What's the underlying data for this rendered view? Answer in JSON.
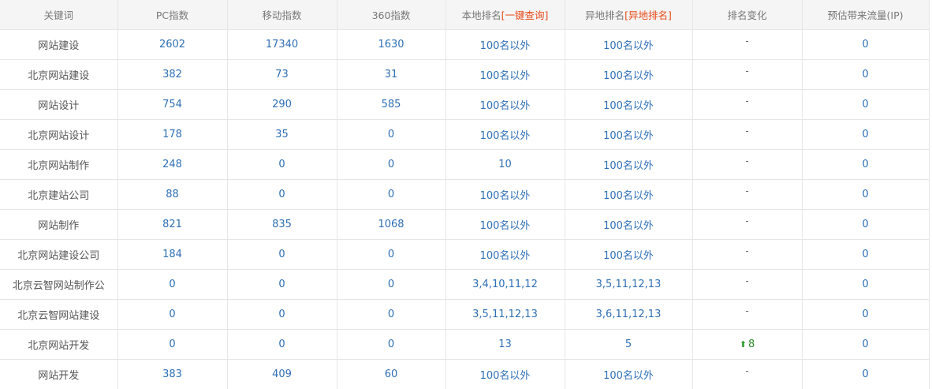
{
  "headers": {
    "keyword": "关键词",
    "pc": "PC指数",
    "mobile": "移动指数",
    "idx360": "360指数",
    "local_rank": "本地排名",
    "local_query": "[一键查询]",
    "remote_rank": "异地排名",
    "remote_query": "[异地排名]",
    "rank_change": "排名变化",
    "traffic": "预估带来流量(IP)"
  },
  "rows": [
    {
      "keyword": "网站建设",
      "pc": "2602",
      "mobile": "17340",
      "idx360": "1630",
      "local": "100名以外",
      "remote": "100名以外",
      "change": "-",
      "traffic": "0"
    },
    {
      "keyword": "北京网站建设",
      "pc": "382",
      "mobile": "73",
      "idx360": "31",
      "local": "100名以外",
      "remote": "100名以外",
      "change": "-",
      "traffic": "0"
    },
    {
      "keyword": "网站设计",
      "pc": "754",
      "mobile": "290",
      "idx360": "585",
      "local": "100名以外",
      "remote": "100名以外",
      "change": "-",
      "traffic": "0"
    },
    {
      "keyword": "北京网站设计",
      "pc": "178",
      "mobile": "35",
      "idx360": "0",
      "local": "100名以外",
      "remote": "100名以外",
      "change": "-",
      "traffic": "0"
    },
    {
      "keyword": "北京网站制作",
      "pc": "248",
      "mobile": "0",
      "idx360": "0",
      "local": "10",
      "remote": "100名以外",
      "change": "-",
      "traffic": "0"
    },
    {
      "keyword": "北京建站公司",
      "pc": "88",
      "mobile": "0",
      "idx360": "0",
      "local": "100名以外",
      "remote": "100名以外",
      "change": "-",
      "traffic": "0"
    },
    {
      "keyword": "网站制作",
      "pc": "821",
      "mobile": "835",
      "idx360": "1068",
      "local": "100名以外",
      "remote": "100名以外",
      "change": "-",
      "traffic": "0"
    },
    {
      "keyword": "北京网站建设公司",
      "pc": "184",
      "mobile": "0",
      "idx360": "0",
      "local": "100名以外",
      "remote": "100名以外",
      "change": "-",
      "traffic": "0"
    },
    {
      "keyword": "北京云智网站制作公",
      "pc": "0",
      "mobile": "0",
      "idx360": "0",
      "local": "3,4,10,11,12",
      "remote": "3,5,11,12,13",
      "change": "-",
      "traffic": "0"
    },
    {
      "keyword": "北京云智网站建设",
      "pc": "0",
      "mobile": "0",
      "idx360": "0",
      "local": "3,5,11,12,13",
      "remote": "3,6,11,12,13",
      "change": "-",
      "traffic": "0"
    },
    {
      "keyword": "北京网站开发",
      "pc": "0",
      "mobile": "0",
      "idx360": "0",
      "local": "13",
      "remote": "5",
      "change": "8",
      "change_dir": "up",
      "traffic": "0"
    },
    {
      "keyword": "网站开发",
      "pc": "383",
      "mobile": "409",
      "idx360": "60",
      "local": "100名以外",
      "remote": "100名以外",
      "change": "-",
      "traffic": "0"
    }
  ],
  "colors": {
    "number_blue": "#2f6fb5",
    "accent_red": "#e64a19",
    "up_green": "#2f9a2f",
    "header_bg": "#f5f5f5"
  },
  "icons": {
    "up": "up-arrow-icon"
  }
}
